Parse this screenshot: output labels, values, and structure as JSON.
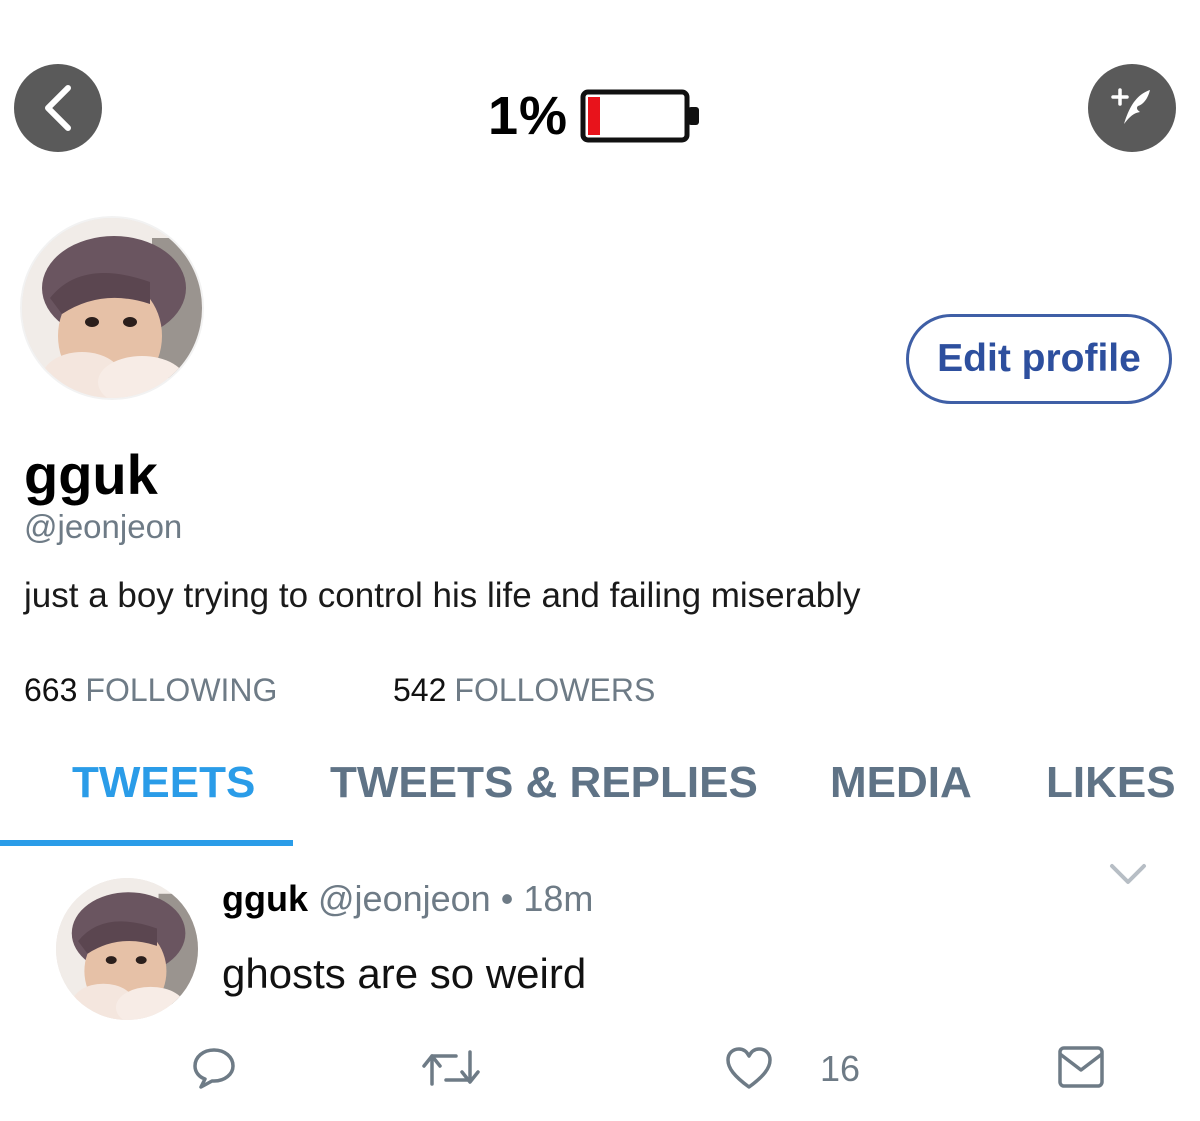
{
  "topbar": {
    "battery_text": "1%",
    "battery_level": 0.01,
    "back_icon": "chevron-left-icon",
    "compose_icon": "quill-compose-icon"
  },
  "profile": {
    "display_name": "gguk",
    "handle": "@jeonjeon",
    "bio": "just a boy trying to control his life and failing miserably",
    "edit_profile_label": "Edit profile",
    "following_count": "663",
    "following_label": "FOLLOWING",
    "followers_count": "542",
    "followers_label": "FOLLOWERS"
  },
  "tabs": [
    {
      "label": "TWEETS",
      "active": true
    },
    {
      "label": "TWEETS & REPLIES",
      "active": false
    },
    {
      "label": "MEDIA",
      "active": false
    },
    {
      "label": "LIKES",
      "active": false
    }
  ],
  "tweet": {
    "name": "gguk",
    "handle": "@jeonjeon",
    "separator": "•",
    "time": "18m",
    "text": "ghosts are so weird",
    "like_count": "16"
  },
  "colors": {
    "accent": "#2a9ce8",
    "button_border": "#3f5fa6",
    "muted": "#6e7b86",
    "battery_red": "#e8131b"
  }
}
